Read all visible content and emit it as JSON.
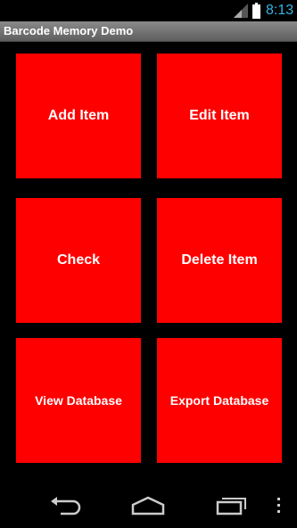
{
  "status_bar": {
    "time": "8:13",
    "accent_color": "#33b5e5",
    "icons": [
      "signal-icon",
      "battery-icon"
    ]
  },
  "app": {
    "title": "Barcode Memory Demo"
  },
  "tiles": [
    {
      "label": "Add Item"
    },
    {
      "label": "Edit Item"
    },
    {
      "label": "Check"
    },
    {
      "label": "Delete Item"
    },
    {
      "label": "View Database"
    },
    {
      "label": "Export Database"
    }
  ],
  "tile_color": "#ff0000",
  "nav_bar": {
    "icons": [
      "back-icon",
      "home-icon",
      "recent-apps-icon",
      "overflow-menu-icon"
    ]
  }
}
